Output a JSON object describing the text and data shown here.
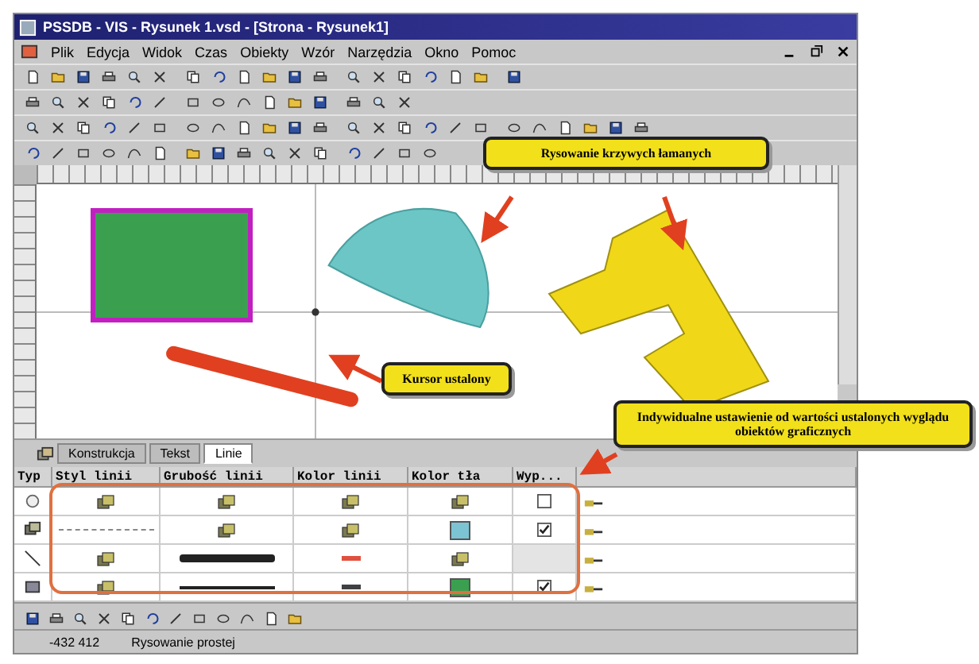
{
  "window": {
    "title": "PSSDB - VIS - Rysunek 1.vsd - [Strona - Rysunek1]"
  },
  "menu": [
    "Plik",
    "Edycja",
    "Widok",
    "Czas",
    "Obiekty",
    "Wzór",
    "Narzędzia",
    "Okno",
    "Pomoc"
  ],
  "canvas_tabs": [
    {
      "label": "Konstrukcja",
      "selected": false
    },
    {
      "label": "Tekst",
      "selected": false
    },
    {
      "label": "Linie",
      "selected": true
    }
  ],
  "table": {
    "columns": [
      "Typ",
      "Styl linii",
      "Grubość linii",
      "Kolor linii",
      "Kolor tła",
      "Wyp..."
    ],
    "rows": [
      {
        "cells": [
          {
            "kind": "default"
          },
          {
            "kind": "default"
          },
          {
            "kind": "default"
          },
          {
            "kind": "default"
          },
          {
            "kind": "checkbox",
            "checked": false
          }
        ]
      },
      {
        "cells": [
          {
            "kind": "dashed-line"
          },
          {
            "kind": "default"
          },
          {
            "kind": "default"
          },
          {
            "kind": "swatch",
            "color": "#7cc4d4"
          },
          {
            "kind": "checkbox",
            "checked": true
          }
        ]
      },
      {
        "cells": [
          {
            "kind": "default"
          },
          {
            "kind": "thick-line"
          },
          {
            "kind": "dash",
            "color": "#e05040"
          },
          {
            "kind": "default"
          },
          {
            "kind": "none"
          }
        ]
      },
      {
        "cells": [
          {
            "kind": "default"
          },
          {
            "kind": "thin-line"
          },
          {
            "kind": "dash",
            "color": "#404040"
          },
          {
            "kind": "swatch",
            "color": "#3aa050"
          },
          {
            "kind": "checkbox",
            "checked": true
          }
        ]
      }
    ]
  },
  "callouts": [
    {
      "text": "Rysowanie krzywych łamanych"
    },
    {
      "text": "Kursor ustalony"
    },
    {
      "text": "Indywidualne ustawienie od wartości ustalonych wyglądu obiektów graficznych"
    }
  ],
  "status_bar": {
    "coords": "-432 412",
    "message": "Rysowanie prostej"
  }
}
